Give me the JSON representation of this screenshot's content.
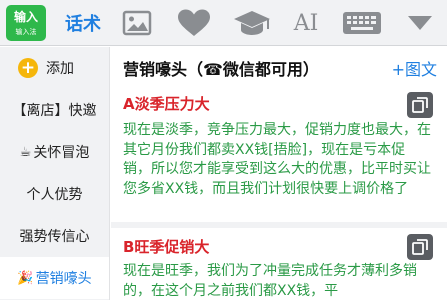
{
  "toolbar": {
    "logo_line1": "输入",
    "logo_line2": "输入法",
    "huashu_label": "话术",
    "ai_label": "AI",
    "icons": [
      "image-icon",
      "heart-icon",
      "graduation-cap-icon",
      "keyboard-icon",
      "chevron-down-icon"
    ]
  },
  "sidebar": {
    "items": [
      {
        "label": "添加"
      },
      {
        "label": "【离店】快邀"
      },
      {
        "label": "关怀冒泡",
        "emoji": "☕"
      },
      {
        "label": "个人优势"
      },
      {
        "label": "强势传信心"
      },
      {
        "label": "营销嚎头",
        "emoji": "🎉",
        "selected": true
      }
    ]
  },
  "main": {
    "title": "营销嚎头（☎微信都可用）",
    "add_image_label": "+图文",
    "cards": [
      {
        "title": "A淡季压力大",
        "body": "现在是淡季，竞争压力最大，促销力度也最大，在其它月份我们都卖XX钱[捂脸]，现在是亏本促销，所以您才能享受到这么大的优惠，比平时买让您多省XX钱，而且我们计划很快要上调价格了"
      },
      {
        "title": "B旺季促销大",
        "body": "现在是旺季，我们为了冲量完成任务才薄利多销的，在这个月之前我们都XX钱，平"
      }
    ]
  },
  "colors": {
    "accent_blue": "#1f7fe0",
    "title_red": "#d9242b",
    "body_green": "#2a9a46",
    "logo_green": "#2eb84b",
    "add_yellow": "#f5b60b"
  }
}
